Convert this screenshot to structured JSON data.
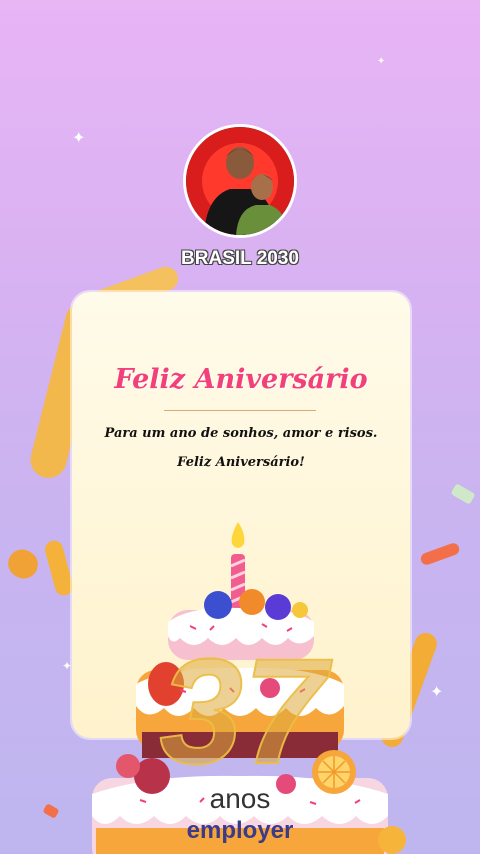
{
  "profile": {
    "name": "BRASIL 2030",
    "avatar_icon": "profile-photo"
  },
  "card": {
    "title": "Feliz Aniversário",
    "line1": "Para um ano de sonhos, amor e risos.",
    "line2": "Feliz Aniversário!"
  },
  "celebration": {
    "age": "37",
    "unit": "anos",
    "cake_icon": "birthday-cake-icon"
  },
  "watermark": "employer",
  "colors": {
    "title": "#f2407a",
    "ribbon": "#f7b733",
    "background_top": "#e8b5f5",
    "background_bottom": "#bfb6ef"
  }
}
